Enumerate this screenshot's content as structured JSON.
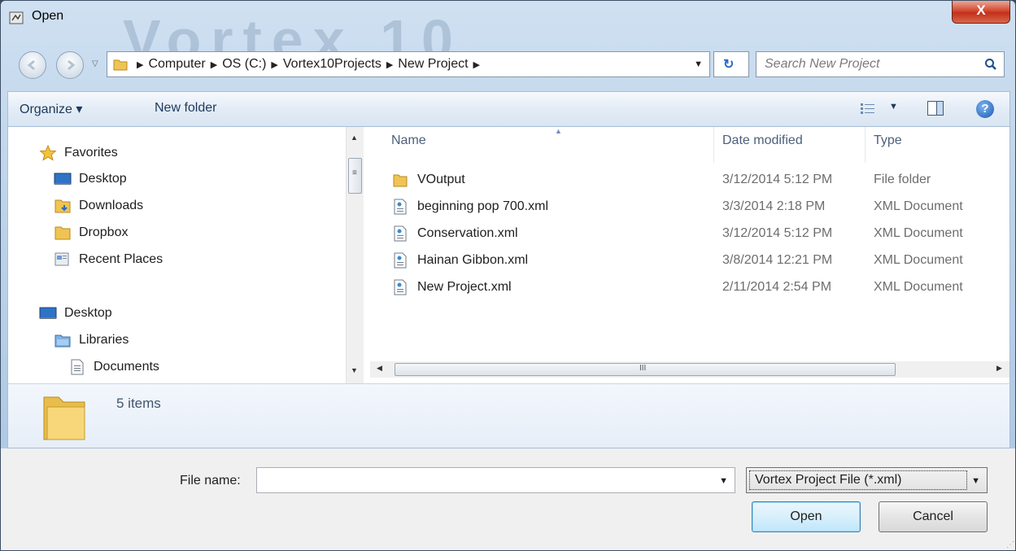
{
  "window": {
    "title": "Open",
    "close_label": "X",
    "watermark": "Vortex 10"
  },
  "address": {
    "crumbs": [
      "Computer",
      "OS (C:)",
      "Vortex10Projects",
      "New Project"
    ],
    "search_placeholder": "Search New Project"
  },
  "toolbar": {
    "organize_label": "Organize ▾",
    "new_folder_label": "New folder",
    "help_label": "?"
  },
  "nav": {
    "items": [
      {
        "label": "Favorites",
        "icon": "star-icon"
      },
      {
        "label": "Desktop",
        "icon": "desktop-icon"
      },
      {
        "label": "Downloads",
        "icon": "downloads-folder-icon"
      },
      {
        "label": "Dropbox",
        "icon": "folder-icon"
      },
      {
        "label": "Recent Places",
        "icon": "recent-places-icon"
      },
      {
        "label": "Desktop",
        "icon": "desktop-icon"
      },
      {
        "label": "Libraries",
        "icon": "libraries-icon"
      },
      {
        "label": "Documents",
        "icon": "document-icon"
      }
    ]
  },
  "files": {
    "columns": {
      "name": "Name",
      "date": "Date modified",
      "type": "Type"
    },
    "rows": [
      {
        "name": "VOutput",
        "date": "3/12/2014 5:12 PM",
        "type": "File folder",
        "icon": "folder-icon"
      },
      {
        "name": "beginning pop 700.xml",
        "date": "3/3/2014 2:18 PM",
        "type": "XML Document",
        "icon": "xml-file-icon"
      },
      {
        "name": "Conservation.xml",
        "date": "3/12/2014 5:12 PM",
        "type": "XML Document",
        "icon": "xml-file-icon"
      },
      {
        "name": "Hainan Gibbon.xml",
        "date": "3/8/2014 12:21 PM",
        "type": "XML Document",
        "icon": "xml-file-icon"
      },
      {
        "name": "New Project.xml",
        "date": "2/11/2014 2:54 PM",
        "type": "XML Document",
        "icon": "xml-file-icon"
      }
    ],
    "hscroll_marker": "III"
  },
  "details": {
    "item_count": "5 items"
  },
  "bottom": {
    "file_name_label": "File name:",
    "file_name_value": "",
    "filter_value": "Vortex Project File (*.xml)",
    "open_label": "Open",
    "cancel_label": "Cancel"
  }
}
